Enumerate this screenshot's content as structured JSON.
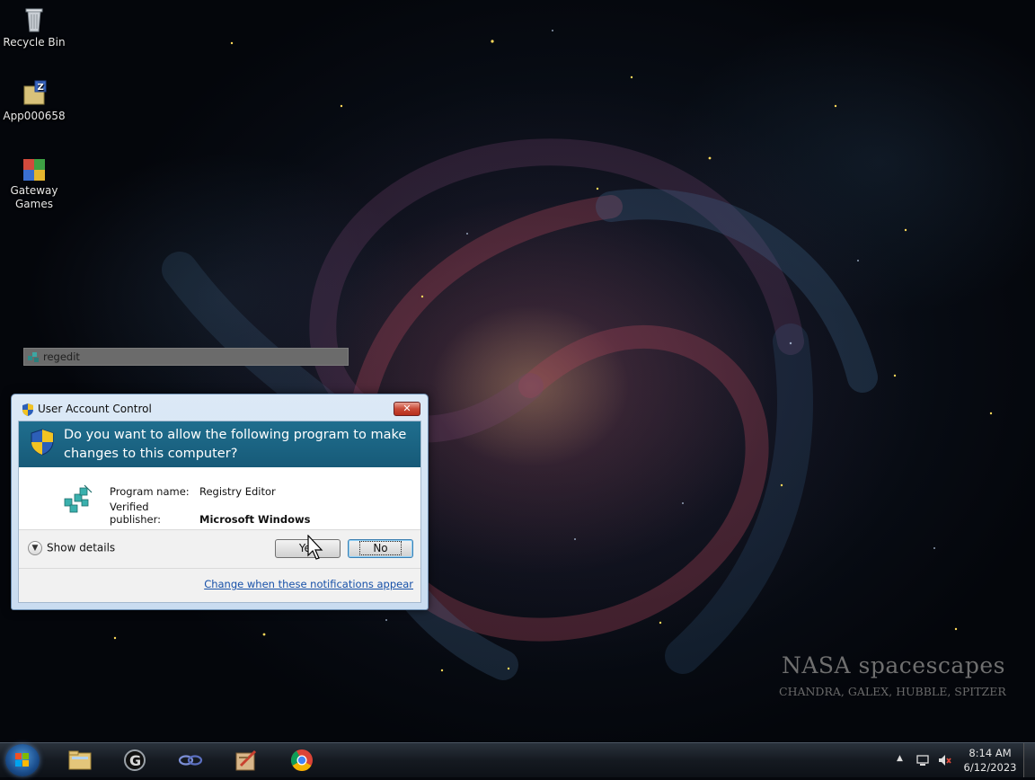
{
  "desktop": {
    "icons": [
      {
        "label": "Recycle Bin",
        "icon": "recycle-bin-icon"
      },
      {
        "label": "App000658",
        "icon": "app-archive-icon"
      },
      {
        "label": "Gateway Games",
        "icon": "gateway-games-icon"
      }
    ],
    "ghost_window_title": "regedit",
    "wallpaper": {
      "title": "NASA spacescapes",
      "credits": "CHANDRA, GALEX, HUBBLE, SPITZER"
    }
  },
  "uac": {
    "title": "User Account Control",
    "close_label": "✕",
    "question": "Do you want to allow the following program to make changes to this computer?",
    "program_name_label": "Program name:",
    "program_name_value": "Registry Editor",
    "publisher_label": "Verified publisher:",
    "publisher_value": "Microsoft Windows",
    "show_details_label": "Show details",
    "yes_label": "Yes",
    "no_label": "No",
    "change_link": "Change when these notifications appear",
    "colors": {
      "header": "#1a6585",
      "link": "#1650a8"
    }
  },
  "taskbar": {
    "pinned": [
      "file-explorer-icon",
      "gateway-g-icon",
      "network-link-icon",
      "registry-editor-icon",
      "chrome-icon"
    ],
    "clock_time": "8:14 AM",
    "clock_date": "6/12/2023",
    "tray_arrow": "▲"
  }
}
